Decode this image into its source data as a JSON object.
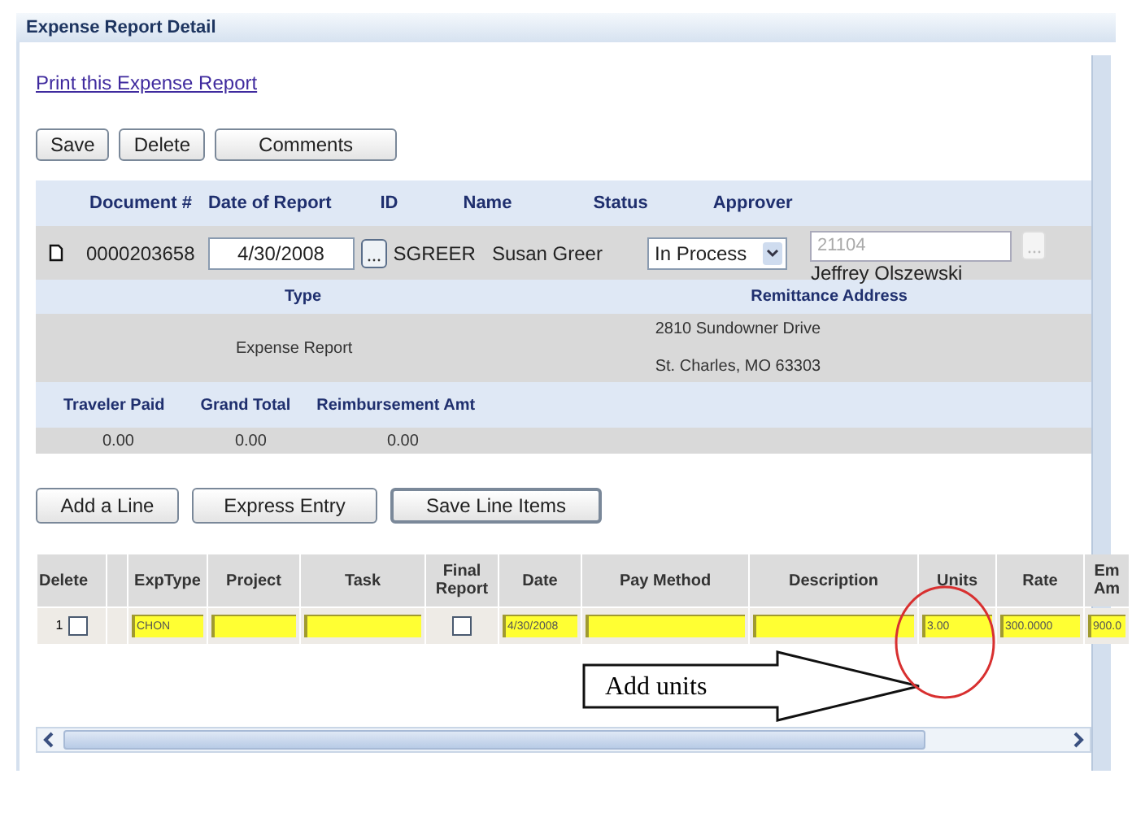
{
  "title": "Expense Report Detail",
  "print_link": "Print this Expense Report",
  "top_buttons": [
    "Save",
    "Delete",
    "Comments"
  ],
  "header": {
    "columns": [
      "Document #",
      "Date of Report",
      "ID",
      "Name",
      "Status",
      "Approver"
    ],
    "document": "0000203658",
    "date": "4/30/2008",
    "id": "SGREER",
    "name": "Susan Greer",
    "status": "In Process",
    "approver_code": "21104",
    "approver_name": "Jeffrey Olszewski"
  },
  "type_label": "Type",
  "type": "Expense Report",
  "remit_label": "Remittance Address",
  "remit_lines": [
    "2810 Sundowner Drive",
    "St. Charles, MO 63303"
  ],
  "totals": [
    {
      "label": "Traveler Paid",
      "value": "0.00"
    },
    {
      "label": "Grand Total",
      "value": "0.00"
    },
    {
      "label": "Reimbursement Amt",
      "value": "0.00"
    }
  ],
  "line_buttons": [
    "Add a Line",
    "Express Entry",
    "Save Line Items"
  ],
  "line_items": {
    "columns": [
      {
        "kind": "text",
        "label": "Delete"
      },
      {
        "kind": "spacer"
      },
      {
        "kind": "text",
        "label": "ExpType"
      },
      {
        "kind": "text",
        "label": "Project"
      },
      {
        "kind": "text",
        "label": "Task"
      },
      {
        "kind": "text",
        "label": "Final Report"
      },
      {
        "kind": "text",
        "label": "Date"
      },
      {
        "kind": "text",
        "label": "Pay Method"
      },
      {
        "kind": "text",
        "label": "Description"
      },
      {
        "kind": "text",
        "label": "Units"
      },
      {
        "kind": "text",
        "label": "Rate"
      },
      {
        "kind": "text",
        "label": "Em Am"
      }
    ],
    "rows": [
      {
        "number": "1",
        "cells": [
          {
            "kind": "check",
            "checked": false
          },
          {
            "kind": "spacer"
          },
          {
            "kind": "field",
            "value": "CHON"
          },
          {
            "kind": "field"
          },
          {
            "kind": "field"
          },
          {
            "kind": "check",
            "checked": false
          },
          {
            "kind": "field",
            "value": "4/30/2008"
          },
          {
            "kind": "field"
          },
          {
            "kind": "field"
          },
          {
            "kind": "field",
            "value": "3.00"
          },
          {
            "kind": "field",
            "value": "300.0000"
          },
          {
            "kind": "field",
            "value": "900.0"
          }
        ]
      }
    ]
  },
  "callout": "Add units"
}
